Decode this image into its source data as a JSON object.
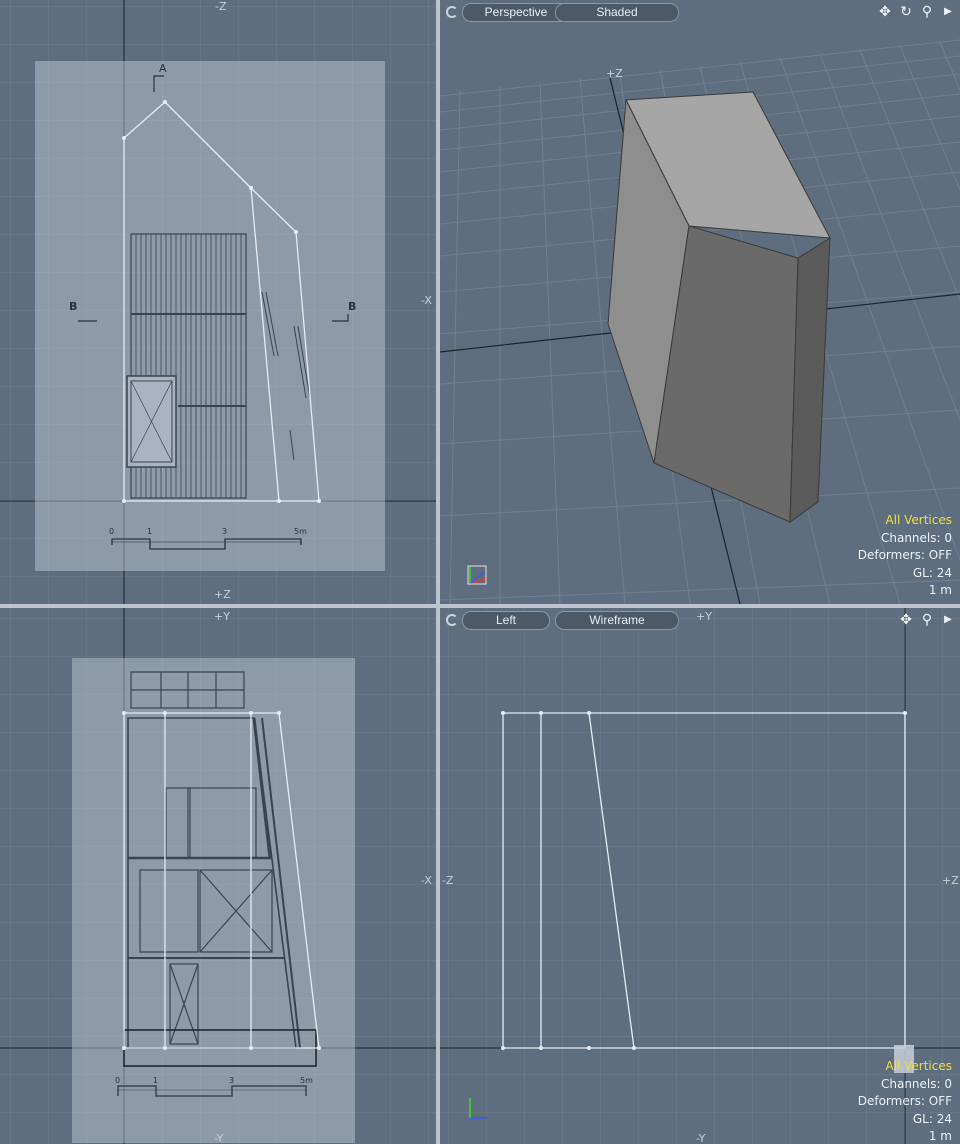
{
  "viewports": {
    "top_left": {
      "axis_labels": {
        "top": "-Z",
        "right": "-X",
        "bottom": "+Z"
      },
      "drawing": {
        "section_a": "A",
        "section_b_left": "B",
        "section_b_right": "B",
        "scale_ticks": [
          "0",
          "1",
          "3",
          "5m"
        ]
      }
    },
    "top_right": {
      "mode_label": "Perspective",
      "shading_label": "Shaded",
      "axis_label": "+Z",
      "stats": {
        "selection": "All Vertices",
        "channels": "Channels: 0",
        "deformers": "Deformers: OFF",
        "gl": "GL: 24",
        "scale": "1 m"
      },
      "tool_icons": [
        "move-icon",
        "rotate-icon",
        "zoom-icon",
        "expand-icon"
      ],
      "accent_color": "#f0dc40"
    },
    "bottom_left": {
      "axis_labels": {
        "top": "+Y",
        "right": "-X",
        "bottom": "-Y"
      },
      "drawing": {
        "scale_ticks": [
          "0",
          "1",
          "3",
          "5m"
        ]
      }
    },
    "bottom_right": {
      "mode_label": "Left",
      "shading_label": "Wireframe",
      "axis_labels": {
        "top": "+Y",
        "left": "-Z",
        "right": "+Z",
        "bottom": "-Y"
      },
      "stats": {
        "selection": "All Vertices",
        "channels": "Channels: 0",
        "deformers": "Deformers: OFF",
        "gl": "GL: 24",
        "scale": "1 m"
      },
      "tool_icons": [
        "move-icon",
        "zoom-icon",
        "expand-icon"
      ]
    }
  }
}
